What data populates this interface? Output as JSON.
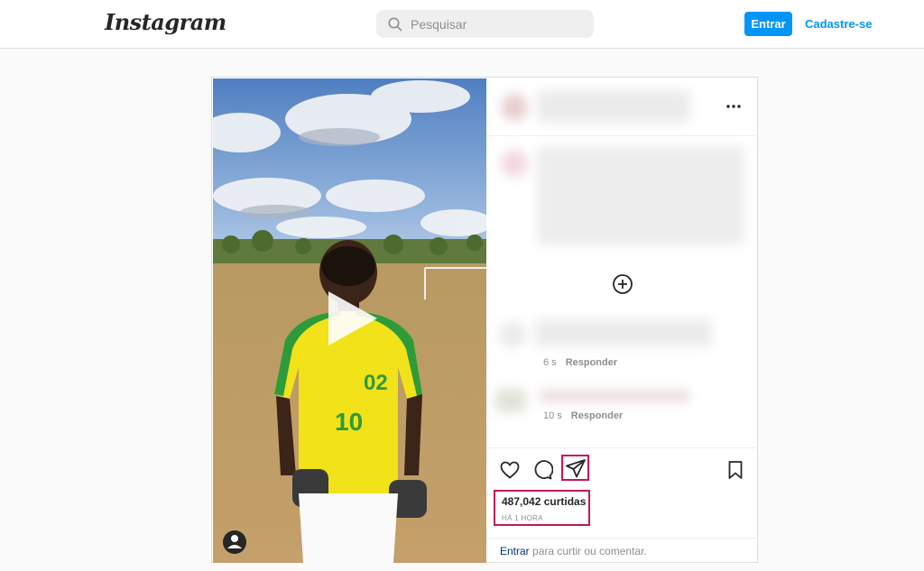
{
  "header": {
    "logo_text": "Instagram",
    "search_placeholder": "Pesquisar",
    "login_label": "Entrar",
    "signup_label": "Cadastre-se"
  },
  "post": {
    "comments": [
      {
        "time": "6 s",
        "reply_label": "Responder"
      },
      {
        "time": "10 s",
        "reply_label": "Responder"
      }
    ],
    "likes_text": "487,042 curtidas",
    "posted_time": "HÁ 1 HORA",
    "footer_link": "Entrar",
    "footer_rest": " para curtir ou comentar."
  },
  "colors": {
    "accent": "#0095f6",
    "highlight": "#c2185b",
    "jersey": "#f2e21a",
    "jersey_trim": "#2e9b3a"
  },
  "icons": [
    "search-icon",
    "more-icon",
    "add-comment-icon",
    "heart-icon",
    "comment-icon",
    "share-icon",
    "bookmark-icon",
    "play-icon",
    "user-icon"
  ]
}
